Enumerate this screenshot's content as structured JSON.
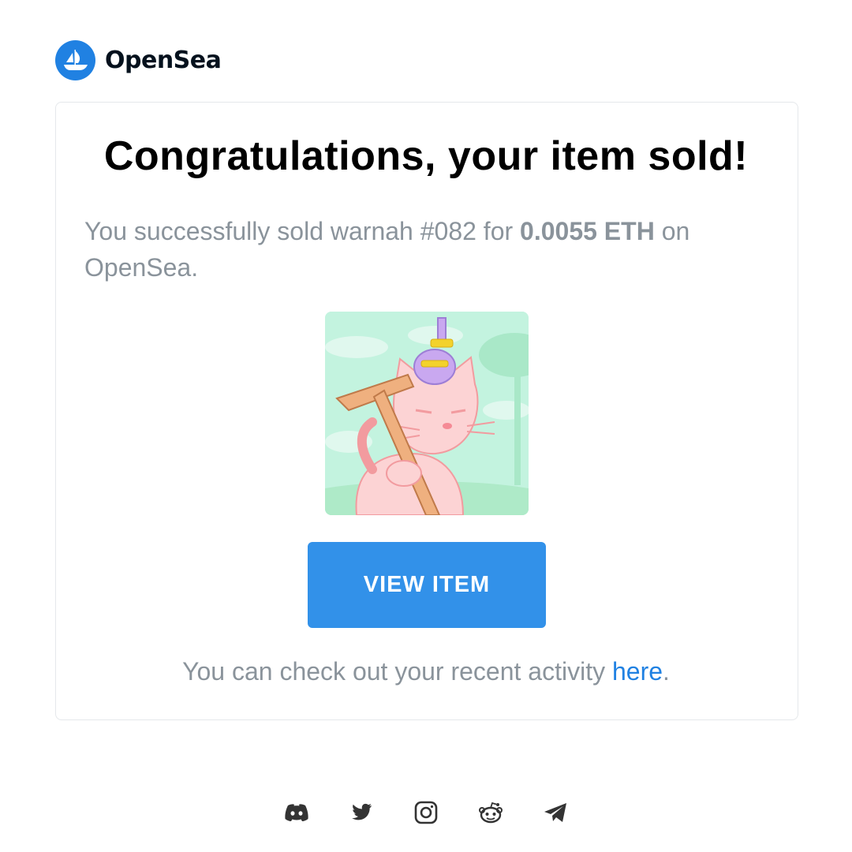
{
  "brand": {
    "name": "OpenSea",
    "color": "#2081e2"
  },
  "email": {
    "title": "Congratulations, your item sold!",
    "message_prefix": "You successfully sold warnah #082 for ",
    "price": "0.0055 ETH",
    "message_suffix": " on OpenSea.",
    "button_label": "VIEW ITEM",
    "activity_prefix": "You can check out your recent activity ",
    "activity_link": "here",
    "activity_suffix": "."
  },
  "socials": [
    {
      "icon": "discord-icon"
    },
    {
      "icon": "twitter-icon"
    },
    {
      "icon": "instagram-icon"
    },
    {
      "icon": "reddit-icon"
    },
    {
      "icon": "telegram-icon"
    }
  ],
  "colors": {
    "button": "#3291e9",
    "muted_text": "#8a939b",
    "link": "#2081e2"
  }
}
